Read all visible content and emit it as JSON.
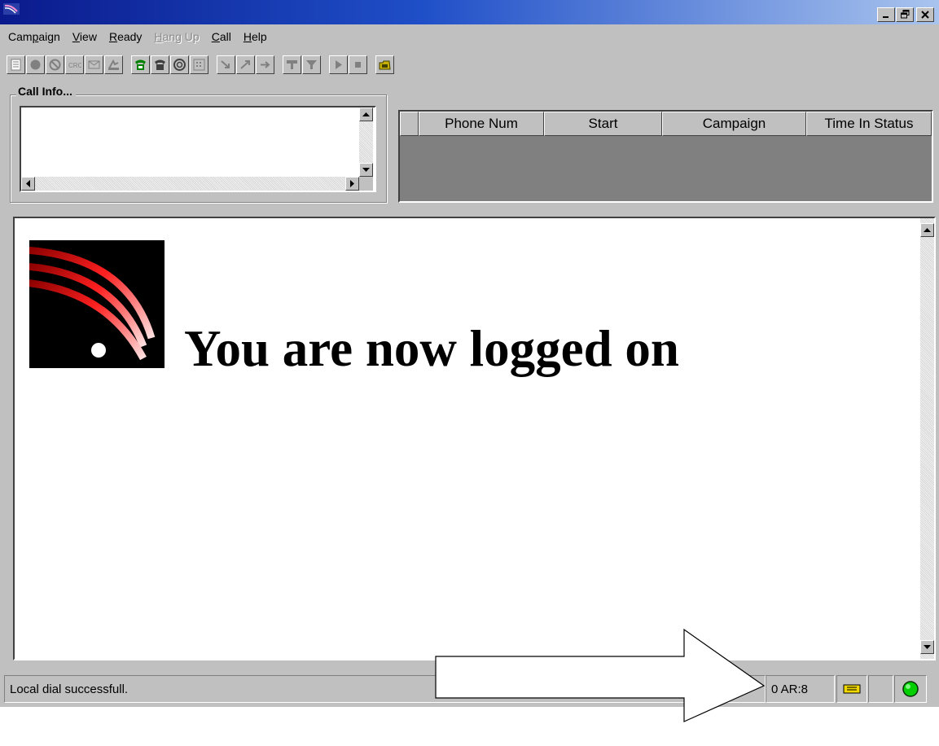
{
  "window": {
    "title": "",
    "controls": [
      "minimize",
      "restore",
      "close"
    ]
  },
  "menu": [
    {
      "label": "Campaign",
      "enabled": true
    },
    {
      "label": "View",
      "enabled": true
    },
    {
      "label": "Ready",
      "enabled": true
    },
    {
      "label": "Hang Up",
      "enabled": false
    },
    {
      "label": "Call",
      "enabled": true
    },
    {
      "label": "Help",
      "enabled": true
    }
  ],
  "toolbar": {
    "icons": [
      "notes-icon",
      "record-icon",
      "no-icon",
      "crc-icon",
      "mail-icon",
      "transfer-icon",
      "phone-green-icon",
      "phone-icon",
      "lifebuoy-icon",
      "dialpad-icon",
      "arrow-in-icon",
      "arrow-up-icon",
      "arrow-out-icon",
      "conference-icon",
      "conference-alt-icon",
      "play-icon",
      "stop-icon",
      "folder-phone-icon"
    ]
  },
  "call_info": {
    "label": "Call Info..."
  },
  "calls_table": {
    "columns": [
      "",
      "Phone Num",
      "Start",
      "Campaign",
      "Time In Status"
    ],
    "rows": []
  },
  "content": {
    "message": "You are now logged on"
  },
  "status": {
    "message": "Local dial successfull.",
    "counter": "0 AR:8",
    "indicator_color": "#00d000"
  }
}
